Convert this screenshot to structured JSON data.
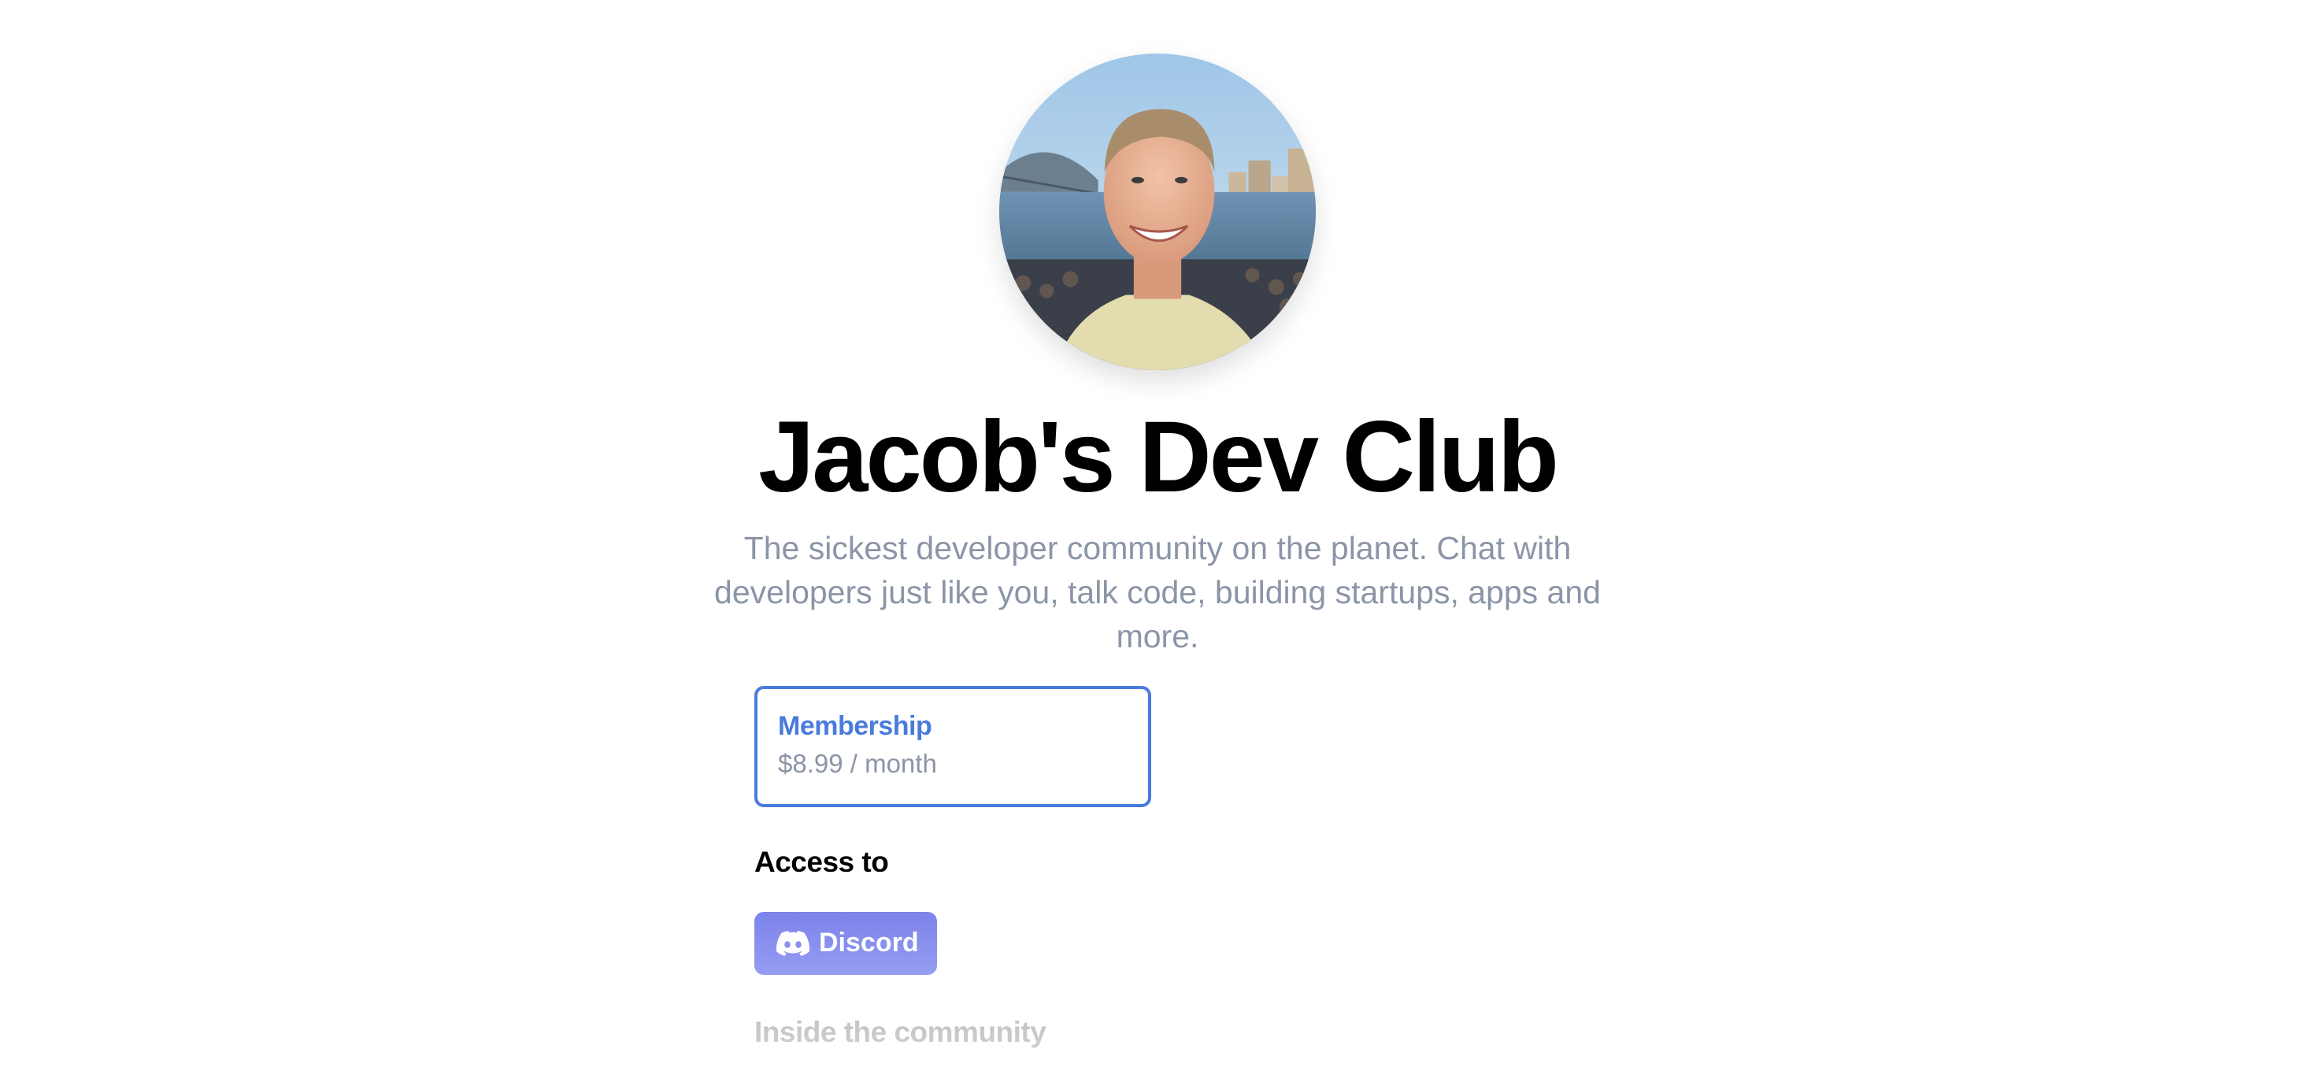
{
  "profile": {
    "title": "Jacob's Dev Club",
    "description": "The sickest developer community on the planet. Chat with developers just like you, talk code, building startups, apps and more.",
    "avatar_icon": "profile-photo"
  },
  "plan": {
    "name": "Membership",
    "price": "$8.99 / month",
    "accent_color": "#4a7bdc"
  },
  "access": {
    "heading": "Access to",
    "items": [
      {
        "label": "Discord",
        "icon": "discord-icon",
        "color": "#7c83ea"
      }
    ]
  },
  "community": {
    "heading": "Inside the community"
  }
}
